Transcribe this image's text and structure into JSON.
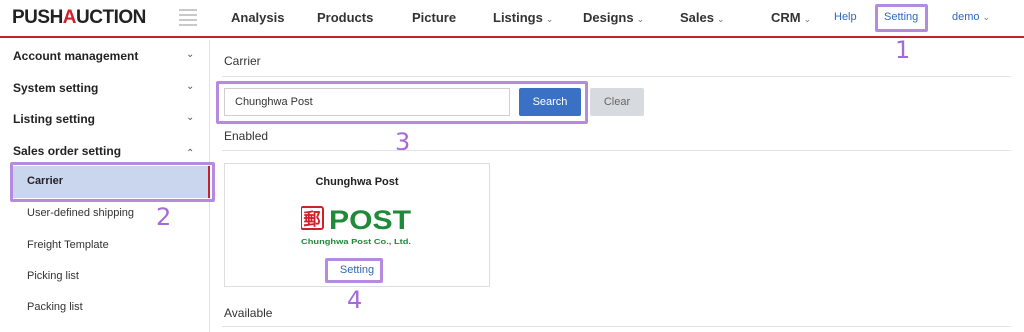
{
  "brand": {
    "logo_prefix": "PUSH",
    "logo_accent": "A",
    "logo_suffix": "UCTION"
  },
  "nav": {
    "analysis": "Analysis",
    "products": "Products",
    "picture": "Picture",
    "listings": "Listings",
    "designs": "Designs",
    "sales": "Sales",
    "crm": "CRM",
    "help": "Help",
    "setting": "Setting",
    "user": "demo",
    "chevron": "⌄"
  },
  "sidebar": {
    "sections": [
      {
        "label": "Account management",
        "chevron": "⌄"
      },
      {
        "label": "System setting",
        "chevron": "⌄"
      },
      {
        "label": "Listing setting",
        "chevron": "⌄"
      },
      {
        "label": "Sales order setting",
        "chevron": "⌃"
      }
    ],
    "items": [
      {
        "label": "Carrier",
        "active": true
      },
      {
        "label": "User-defined shipping"
      },
      {
        "label": "Freight Template"
      },
      {
        "label": "Picking list"
      },
      {
        "label": "Packing list"
      }
    ]
  },
  "main": {
    "breadcrumb": "Carrier",
    "search": {
      "value": "Chunghwa Post",
      "button": "Search",
      "clear": "Clear"
    },
    "enabled_heading": "Enabled",
    "available_heading": "Available",
    "carrier_card": {
      "title": "Chunghwa Post",
      "logo_word": "POST",
      "logo_caption": "Chunghwa Post Co., Ltd.",
      "logo_glyph": "郵",
      "setting_link": "Setting"
    }
  },
  "annotations": [
    "1",
    "2",
    "3",
    "4"
  ],
  "colors": {
    "accent_red": "#c8202f",
    "primary_blue": "#3a71c4",
    "link_blue": "#2c6ab8",
    "highlight_purple": "#b48be0",
    "active_row_bg": "#c9d6ee",
    "post_green": "#1f8a3a",
    "post_red": "#d0202c"
  },
  "icons": [
    "menu-icon",
    "chevron-down-icon",
    "chevron-up-icon",
    "chunghwa-post-logo"
  ]
}
